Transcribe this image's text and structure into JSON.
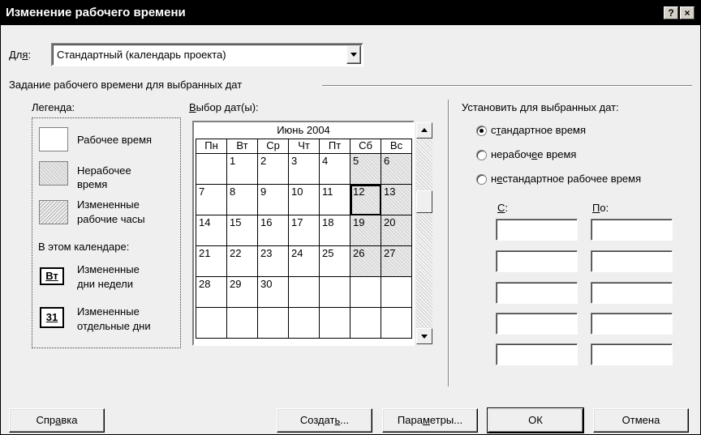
{
  "window": {
    "title": "Изменение рабочего времени",
    "help_btn": "?",
    "close_btn": "×"
  },
  "for": {
    "label_pre": "Дл",
    "label_acc": "я",
    "label_post": ":",
    "value": "Стандартный (календарь проекта)"
  },
  "group_title": "Задание рабочего времени для выбранных дат",
  "legend": {
    "title": "Легенда:",
    "working": "Рабочее время",
    "nonworking_1": "Нерабочее",
    "nonworking_2": "время",
    "changed_1": "Измененные",
    "changed_2": "рабочие часы",
    "in_calendar": "В этом календаре:",
    "weekday_icon": "Вт",
    "weekday_1": "Измененные",
    "weekday_2": "дни недели",
    "day_icon": "31",
    "day_1": "Измененные",
    "day_2": "отдельные дни"
  },
  "dates": {
    "label_acc": "В",
    "label_rest": "ыбор дат(ы):",
    "month": "Июнь 2004",
    "weekdays": [
      "Пн",
      "Вт",
      "Ср",
      "Чт",
      "Пт",
      "Сб",
      "Вс"
    ],
    "weeks": [
      [
        "",
        "1",
        "2",
        "3",
        "4",
        "5",
        "6"
      ],
      [
        "7",
        "8",
        "9",
        "10",
        "11",
        "12",
        "13"
      ],
      [
        "14",
        "15",
        "16",
        "17",
        "18",
        "19",
        "20"
      ],
      [
        "21",
        "22",
        "23",
        "24",
        "25",
        "26",
        "27"
      ],
      [
        "28",
        "29",
        "30",
        "",
        "",
        "",
        ""
      ],
      [
        "",
        "",
        "",
        "",
        "",
        "",
        ""
      ]
    ],
    "selected": "12"
  },
  "set_for": {
    "title": "Установить для выбранных дат:",
    "opt1_pre": "с",
    "opt1_acc": "т",
    "opt1_post": "андартное время",
    "opt2_pre": "нерабоч",
    "opt2_acc": "е",
    "opt2_post": "е время",
    "opt3_pre": "н",
    "opt3_acc": "е",
    "opt3_post": "стандартное рабочее время",
    "from_acc": "С",
    "from_post": ":",
    "to_acc": "П",
    "to_post": "о:"
  },
  "buttons": {
    "help_pre": "Спр",
    "help_acc": "а",
    "help_post": "вка",
    "create_pre": "Создат",
    "create_acc": "ь",
    "create_post": "...",
    "params_pre": "Пара",
    "params_acc": "м",
    "params_post": "етры...",
    "ok": "ОК",
    "cancel": "Отмена"
  }
}
